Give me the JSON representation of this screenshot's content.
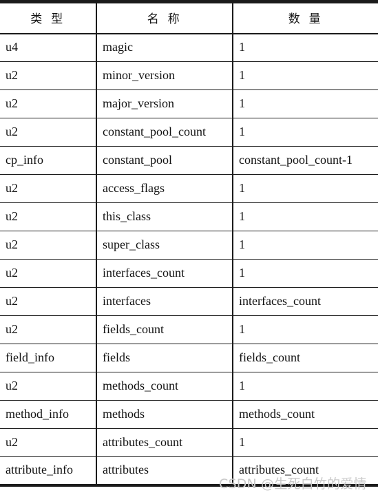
{
  "document": {
    "kind": "class-file-structure-table",
    "language": "zh-CN"
  },
  "table": {
    "headers": {
      "type": "类  型",
      "name": "名  称",
      "quantity": "数  量"
    },
    "rows": [
      {
        "type": "u4",
        "name": "magic",
        "quantity": "1"
      },
      {
        "type": "u2",
        "name": "minor_version",
        "quantity": "1"
      },
      {
        "type": "u2",
        "name": "major_version",
        "quantity": "1"
      },
      {
        "type": "u2",
        "name": "constant_pool_count",
        "quantity": "1"
      },
      {
        "type": "cp_info",
        "name": "constant_pool",
        "quantity": "constant_pool_count-1"
      },
      {
        "type": "u2",
        "name": "access_flags",
        "quantity": "1"
      },
      {
        "type": "u2",
        "name": "this_class",
        "quantity": "1"
      },
      {
        "type": "u2",
        "name": "super_class",
        "quantity": "1"
      },
      {
        "type": "u2",
        "name": "interfaces_count",
        "quantity": "1"
      },
      {
        "type": "u2",
        "name": "interfaces",
        "quantity": "interfaces_count"
      },
      {
        "type": "u2",
        "name": "fields_count",
        "quantity": "1"
      },
      {
        "type": "field_info",
        "name": "fields",
        "quantity": "fields_count"
      },
      {
        "type": "u2",
        "name": "methods_count",
        "quantity": "1"
      },
      {
        "type": "method_info",
        "name": "methods",
        "quantity": "methods_count"
      },
      {
        "type": "u2",
        "name": "attributes_count",
        "quantity": "1"
      },
      {
        "type": "attribute_info",
        "name": "attributes",
        "quantity": "attributes_count"
      }
    ]
  },
  "watermark": {
    "text": "CSDN @生死白竹的爱情",
    "color": "#c9c9c9"
  },
  "colors": {
    "rule": "#1b1b1b",
    "text": "#111111",
    "background": "#ffffff"
  }
}
